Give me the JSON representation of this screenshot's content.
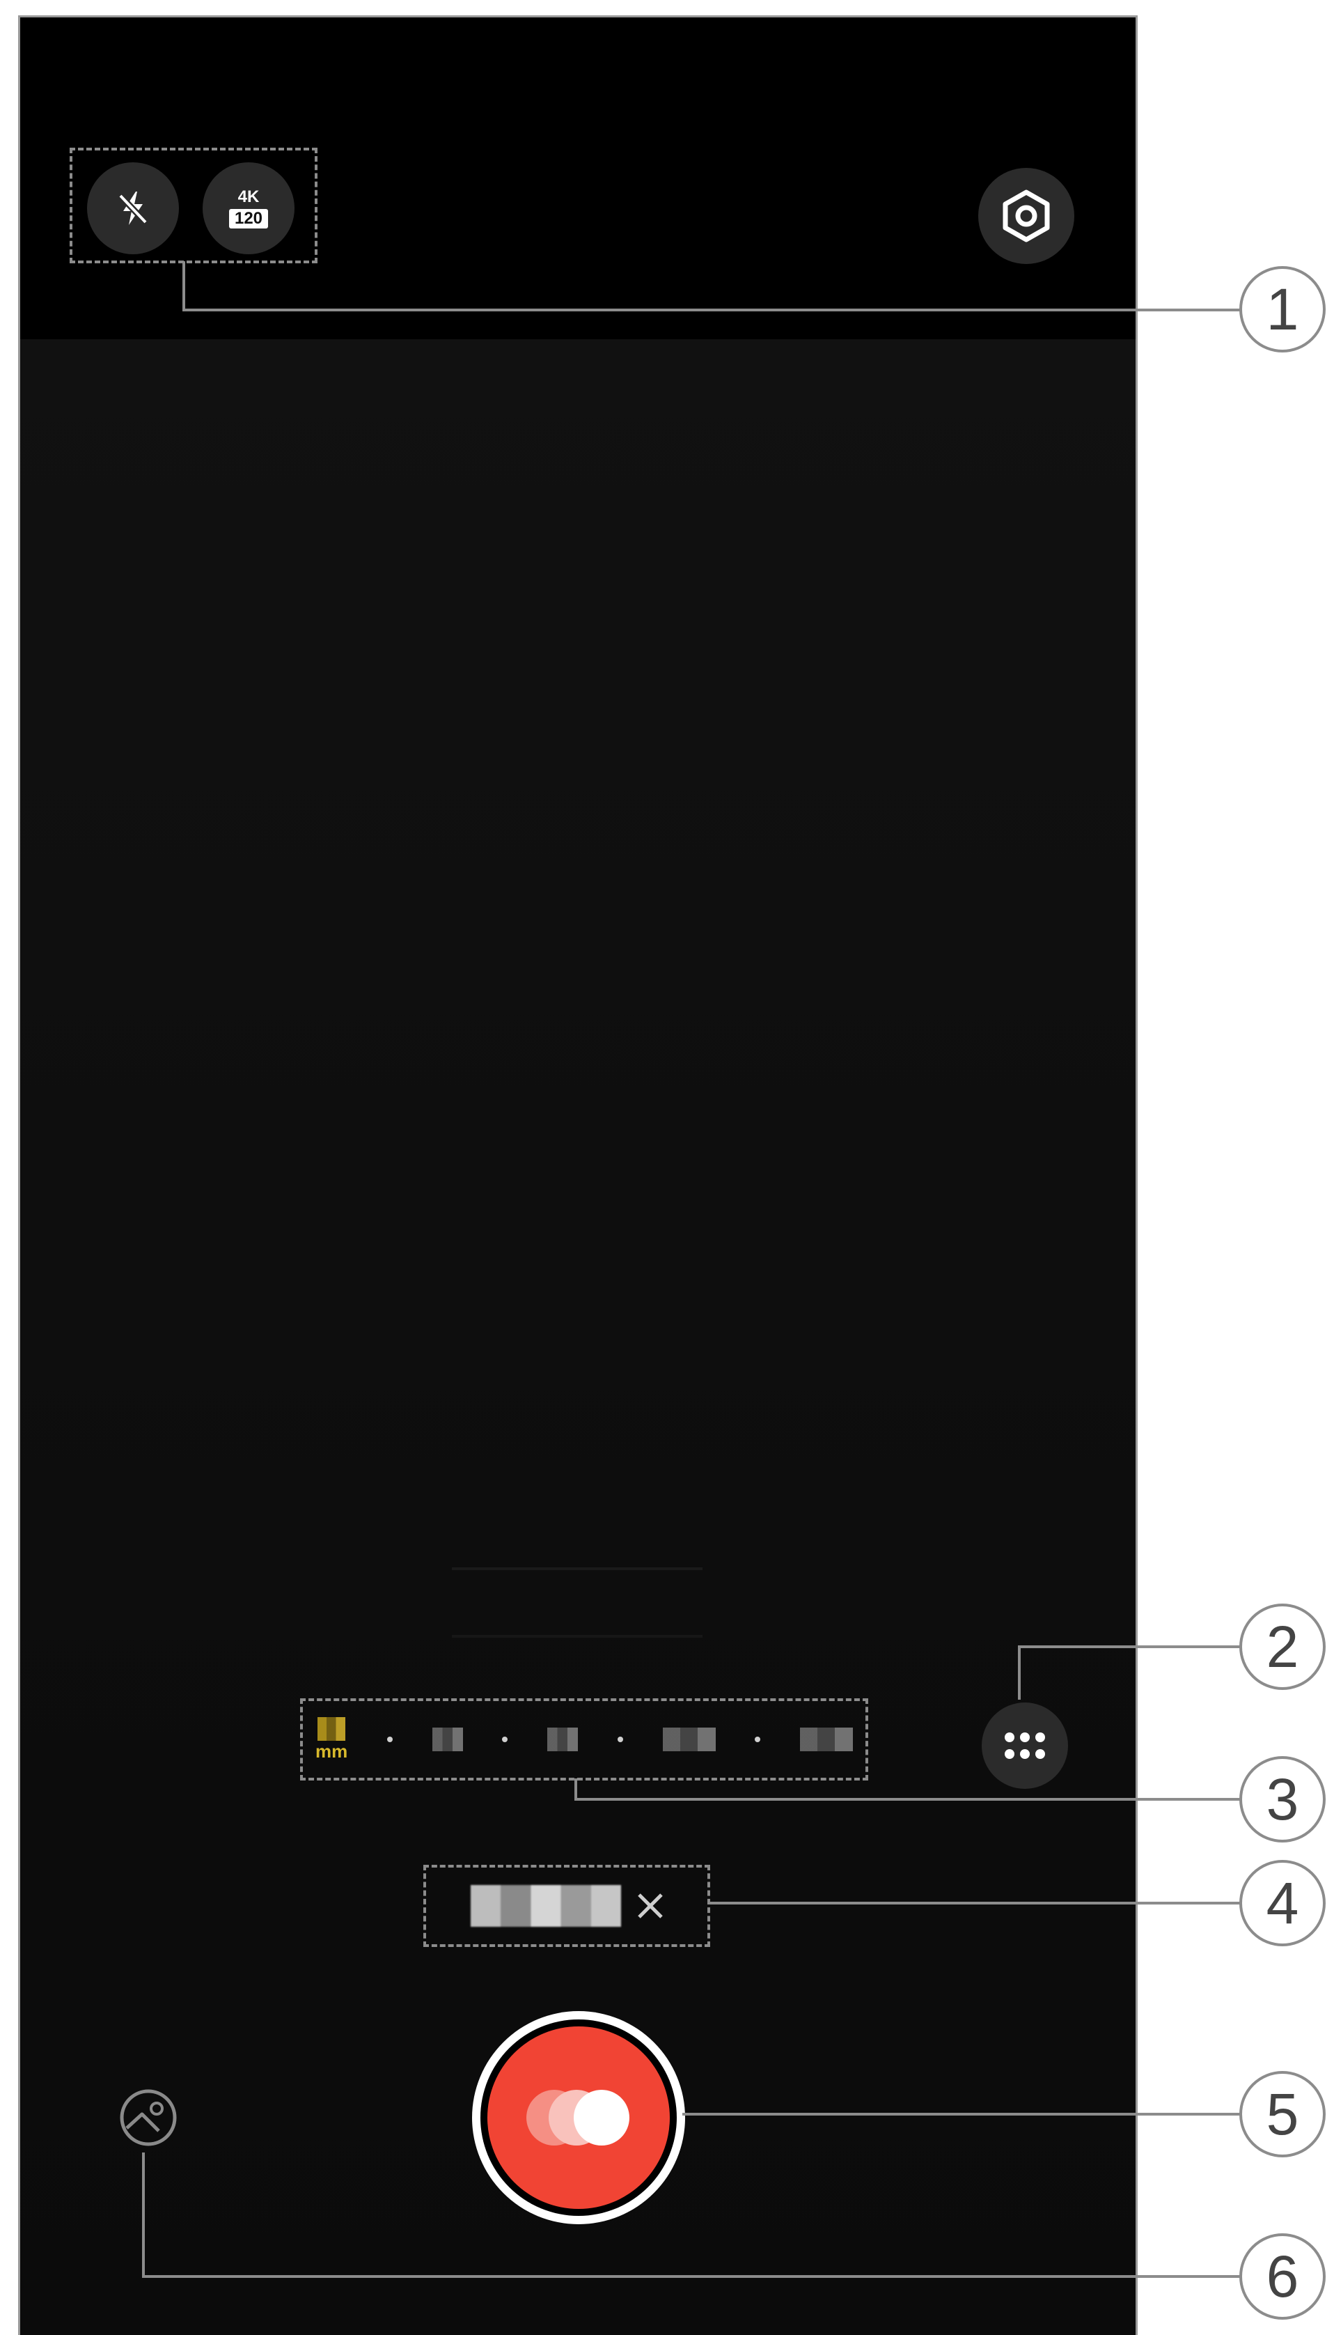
{
  "top_bar": {
    "flash_icon": "flash-off-icon",
    "resolution": {
      "top": "4K",
      "bottom": "120"
    },
    "settings_icon": "hexagon-settings-icon"
  },
  "zoom": {
    "active_unit": "mm"
  },
  "more_icon": "grid-dots-icon",
  "record_icon": "record-button-icon",
  "gallery_icon": "gallery-icon",
  "callouts": [
    "1",
    "2",
    "3",
    "4",
    "5",
    "6"
  ],
  "colors": {
    "record_red": "#f14434",
    "zoom_gold": "#d8b92c",
    "callout_gray": "#8c8c8c"
  }
}
